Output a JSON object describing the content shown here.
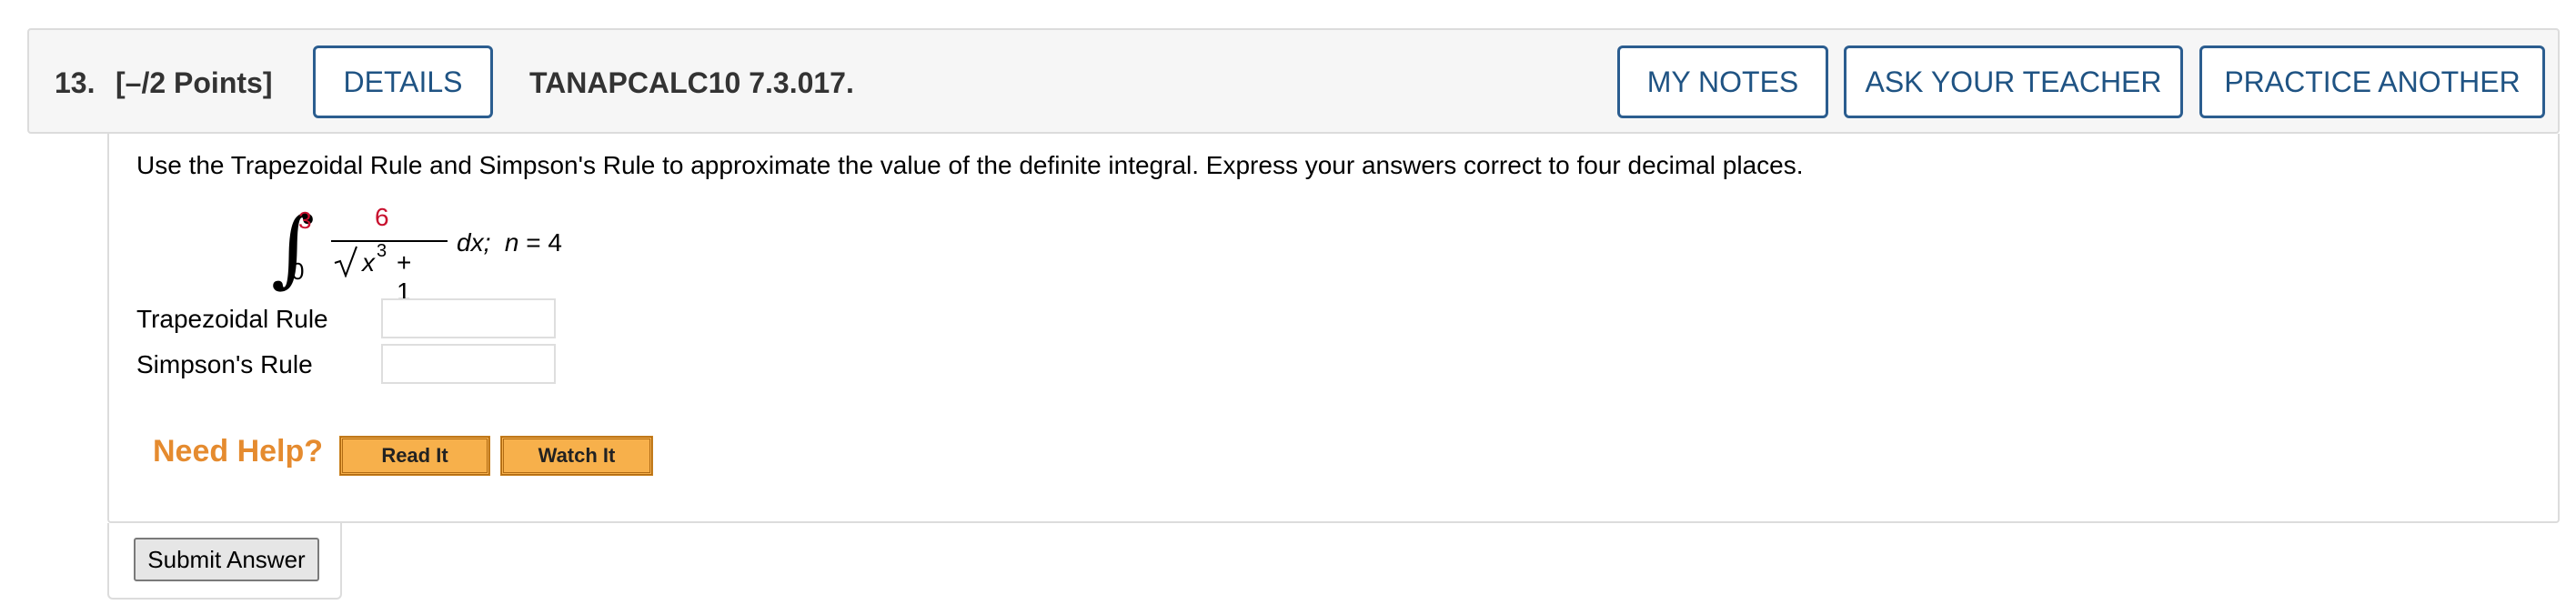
{
  "header": {
    "question_number": "13.",
    "points": "[–/2 Points]",
    "details_label": "DETAILS",
    "question_id": "TANAPCALC10 7.3.017.",
    "my_notes_label": "MY NOTES",
    "ask_teacher_label": "ASK YOUR TEACHER",
    "practice_another_label": "PRACTICE ANOTHER"
  },
  "question": {
    "prompt": "Use the Trapezoidal Rule and Simpson's Rule to approximate the value of the definite integral. Express your answers correct to four decimal places.",
    "integral": {
      "upper_limit": "3",
      "lower_limit": "0",
      "numerator": "6",
      "denominator_var": "x",
      "denominator_exp": "3",
      "denominator_rest": " + 1",
      "differential": "dx;",
      "n_var": "n",
      "n_value": " = 4"
    },
    "trapezoidal_label": "Trapezoidal Rule",
    "trapezoidal_value": "",
    "simpsons_label": "Simpson's Rule",
    "simpsons_value": ""
  },
  "help": {
    "need_help_label": "Need Help?",
    "read_it_label": "Read It",
    "watch_it_label": "Watch It"
  },
  "submit": {
    "label": "Submit Answer"
  },
  "colors": {
    "button_border": "#2b5d8f",
    "button_text": "#1f5383",
    "highlight_red": "#c8102e",
    "need_help_orange": "#e58b2f",
    "help_button_fill": "#f7b04b"
  }
}
